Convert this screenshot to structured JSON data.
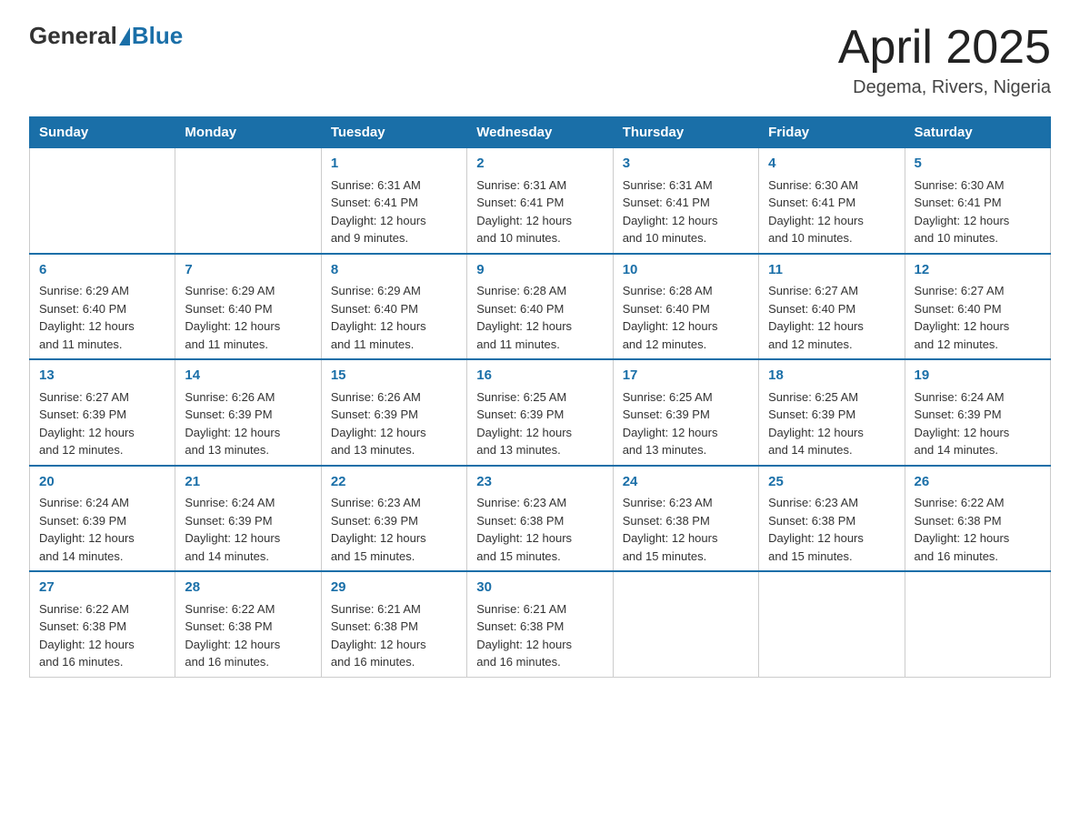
{
  "header": {
    "logo": {
      "general": "General",
      "blue": "Blue"
    },
    "title": "April 2025",
    "location": "Degema, Rivers, Nigeria"
  },
  "weekdays": [
    "Sunday",
    "Monday",
    "Tuesday",
    "Wednesday",
    "Thursday",
    "Friday",
    "Saturday"
  ],
  "weeks": [
    [
      {
        "day": "",
        "info": ""
      },
      {
        "day": "",
        "info": ""
      },
      {
        "day": "1",
        "info": "Sunrise: 6:31 AM\nSunset: 6:41 PM\nDaylight: 12 hours\nand 9 minutes."
      },
      {
        "day": "2",
        "info": "Sunrise: 6:31 AM\nSunset: 6:41 PM\nDaylight: 12 hours\nand 10 minutes."
      },
      {
        "day": "3",
        "info": "Sunrise: 6:31 AM\nSunset: 6:41 PM\nDaylight: 12 hours\nand 10 minutes."
      },
      {
        "day": "4",
        "info": "Sunrise: 6:30 AM\nSunset: 6:41 PM\nDaylight: 12 hours\nand 10 minutes."
      },
      {
        "day": "5",
        "info": "Sunrise: 6:30 AM\nSunset: 6:41 PM\nDaylight: 12 hours\nand 10 minutes."
      }
    ],
    [
      {
        "day": "6",
        "info": "Sunrise: 6:29 AM\nSunset: 6:40 PM\nDaylight: 12 hours\nand 11 minutes."
      },
      {
        "day": "7",
        "info": "Sunrise: 6:29 AM\nSunset: 6:40 PM\nDaylight: 12 hours\nand 11 minutes."
      },
      {
        "day": "8",
        "info": "Sunrise: 6:29 AM\nSunset: 6:40 PM\nDaylight: 12 hours\nand 11 minutes."
      },
      {
        "day": "9",
        "info": "Sunrise: 6:28 AM\nSunset: 6:40 PM\nDaylight: 12 hours\nand 11 minutes."
      },
      {
        "day": "10",
        "info": "Sunrise: 6:28 AM\nSunset: 6:40 PM\nDaylight: 12 hours\nand 12 minutes."
      },
      {
        "day": "11",
        "info": "Sunrise: 6:27 AM\nSunset: 6:40 PM\nDaylight: 12 hours\nand 12 minutes."
      },
      {
        "day": "12",
        "info": "Sunrise: 6:27 AM\nSunset: 6:40 PM\nDaylight: 12 hours\nand 12 minutes."
      }
    ],
    [
      {
        "day": "13",
        "info": "Sunrise: 6:27 AM\nSunset: 6:39 PM\nDaylight: 12 hours\nand 12 minutes."
      },
      {
        "day": "14",
        "info": "Sunrise: 6:26 AM\nSunset: 6:39 PM\nDaylight: 12 hours\nand 13 minutes."
      },
      {
        "day": "15",
        "info": "Sunrise: 6:26 AM\nSunset: 6:39 PM\nDaylight: 12 hours\nand 13 minutes."
      },
      {
        "day": "16",
        "info": "Sunrise: 6:25 AM\nSunset: 6:39 PM\nDaylight: 12 hours\nand 13 minutes."
      },
      {
        "day": "17",
        "info": "Sunrise: 6:25 AM\nSunset: 6:39 PM\nDaylight: 12 hours\nand 13 minutes."
      },
      {
        "day": "18",
        "info": "Sunrise: 6:25 AM\nSunset: 6:39 PM\nDaylight: 12 hours\nand 14 minutes."
      },
      {
        "day": "19",
        "info": "Sunrise: 6:24 AM\nSunset: 6:39 PM\nDaylight: 12 hours\nand 14 minutes."
      }
    ],
    [
      {
        "day": "20",
        "info": "Sunrise: 6:24 AM\nSunset: 6:39 PM\nDaylight: 12 hours\nand 14 minutes."
      },
      {
        "day": "21",
        "info": "Sunrise: 6:24 AM\nSunset: 6:39 PM\nDaylight: 12 hours\nand 14 minutes."
      },
      {
        "day": "22",
        "info": "Sunrise: 6:23 AM\nSunset: 6:39 PM\nDaylight: 12 hours\nand 15 minutes."
      },
      {
        "day": "23",
        "info": "Sunrise: 6:23 AM\nSunset: 6:38 PM\nDaylight: 12 hours\nand 15 minutes."
      },
      {
        "day": "24",
        "info": "Sunrise: 6:23 AM\nSunset: 6:38 PM\nDaylight: 12 hours\nand 15 minutes."
      },
      {
        "day": "25",
        "info": "Sunrise: 6:23 AM\nSunset: 6:38 PM\nDaylight: 12 hours\nand 15 minutes."
      },
      {
        "day": "26",
        "info": "Sunrise: 6:22 AM\nSunset: 6:38 PM\nDaylight: 12 hours\nand 16 minutes."
      }
    ],
    [
      {
        "day": "27",
        "info": "Sunrise: 6:22 AM\nSunset: 6:38 PM\nDaylight: 12 hours\nand 16 minutes."
      },
      {
        "day": "28",
        "info": "Sunrise: 6:22 AM\nSunset: 6:38 PM\nDaylight: 12 hours\nand 16 minutes."
      },
      {
        "day": "29",
        "info": "Sunrise: 6:21 AM\nSunset: 6:38 PM\nDaylight: 12 hours\nand 16 minutes."
      },
      {
        "day": "30",
        "info": "Sunrise: 6:21 AM\nSunset: 6:38 PM\nDaylight: 12 hours\nand 16 minutes."
      },
      {
        "day": "",
        "info": ""
      },
      {
        "day": "",
        "info": ""
      },
      {
        "day": "",
        "info": ""
      }
    ]
  ]
}
